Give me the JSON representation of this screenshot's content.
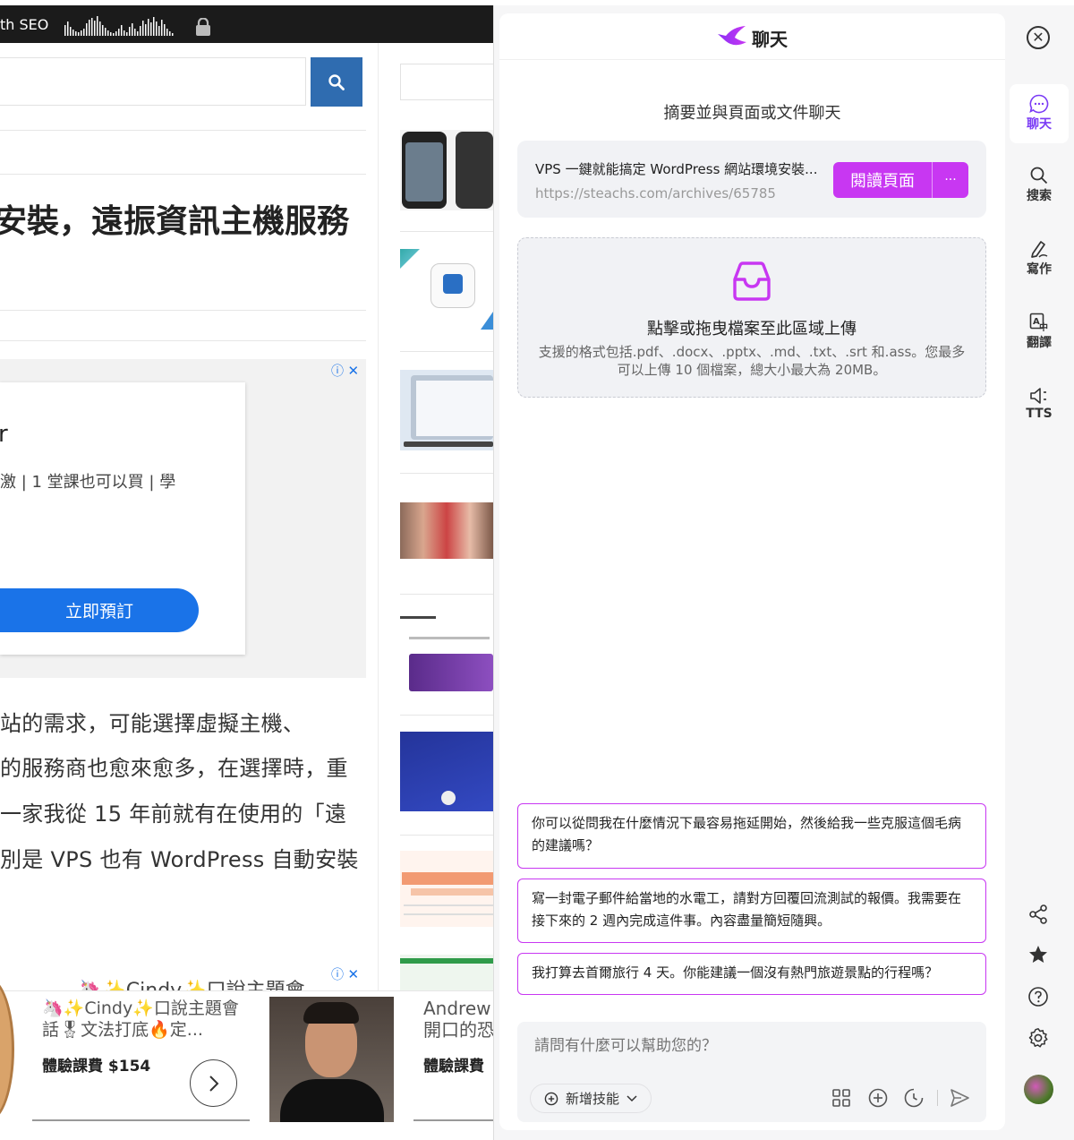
{
  "website": {
    "topbar_text": "th SEO",
    "title_fragment": "安裝，遠振資訊主機服務",
    "ad": {
      "heading_fragment": "r",
      "subtext_fragment": "激 | 1 堂課也可以買 | 學",
      "cta_label": "立即預訂"
    },
    "article_lines": [
      "站的需求，可能選擇虛擬主機、",
      "的服務商也愈來愈多，在選擇時，重",
      "一家我從 15 年前就有在使用的「遠",
      "別是 VPS 也有 WordPress 自動安裝"
    ],
    "bottom_ad": {
      "peek_text": "🦄✨Cindy✨口說主題會",
      "card1_title": "🦄✨Cindy✨口說主題會話🎖文法打底🔥定...",
      "card1_price": "體驗課費 $154",
      "card2_name": "Andrew",
      "card2_title_fragment": "開口的恐",
      "card2_price_fragment": "體驗課費"
    }
  },
  "panel": {
    "header_title": "聊天",
    "summary_label": "摘要並與頁面或文件聊天",
    "page_card": {
      "title": "VPS 一鍵就能搞定 WordPress 網站環境安裝...",
      "url": "https://steachs.com/archives/65785",
      "read_button": "閱讀頁面",
      "more_label": "···"
    },
    "upload": {
      "title": "點擊或拖曳檔案至此區域上傳",
      "description": "支援的格式包括.pdf、.docx、.pptx、.md、.txt、.srt 和.ass。您最多可以上傳 10 個檔案，總大小最大為 20MB。"
    },
    "prompts": [
      "你可以從問我在什麼情況下最容易拖延開始，然後給我一些克服這個毛病的建議嗎？",
      "寫一封電子郵件給當地的水電工，請對方回覆回流測試的報價。我需要在接下來的 2 週內完成這件事。內容盡量簡短隨興。",
      "我打算去首爾旅行 4 天。你能建議一個沒有熱門旅遊景點的行程嗎？"
    ],
    "input": {
      "placeholder": "請問有什麼可以幫助您的？",
      "skill_button": "新增技能"
    },
    "rail": {
      "items": [
        {
          "label": "聊天",
          "icon": "chat-bubble-icon"
        },
        {
          "label": "搜索",
          "icon": "search-icon"
        },
        {
          "label": "寫作",
          "icon": "pen-icon"
        },
        {
          "label": "翻譯",
          "icon": "translate-icon"
        },
        {
          "label": "TTS",
          "icon": "speaker-icon"
        }
      ]
    },
    "accent_color": "#c837f2",
    "active_color": "#7b3cf5"
  }
}
